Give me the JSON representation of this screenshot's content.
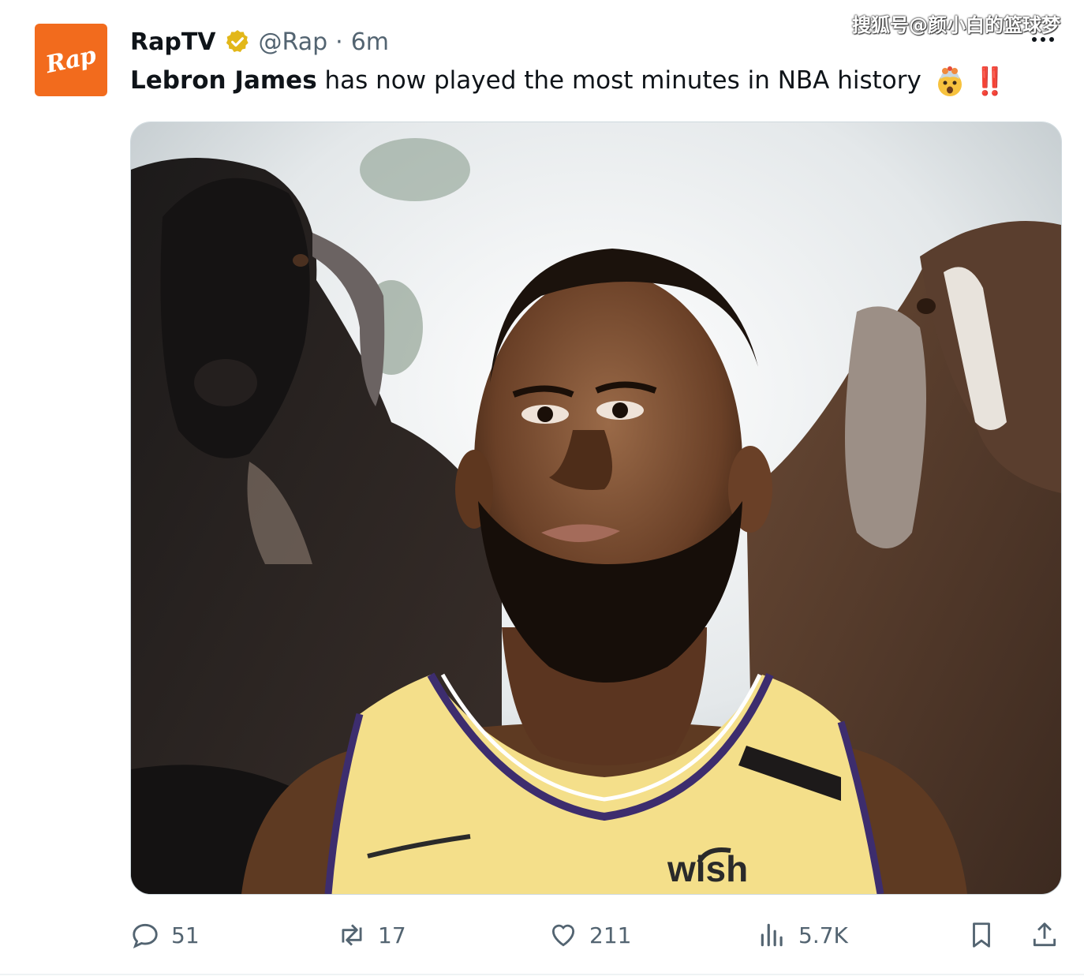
{
  "watermark": "搜狐号@颜小白的篮球梦",
  "author": {
    "avatar_text": "Rap",
    "display_name": "RapTV",
    "handle": "@Rap",
    "separator": "·",
    "time": "6m",
    "verified_color": "#e2b719"
  },
  "tweet": {
    "bold_name": "Lebron James",
    "text": "has now played the most minutes in NBA history",
    "exclaim": "‼️"
  },
  "media": {
    "jersey_brand": "wish"
  },
  "actions": {
    "replies": "51",
    "retweets": "17",
    "likes": "211",
    "views": "5.7K"
  },
  "colors": {
    "avatar_bg": "#f26b1d",
    "secondary_text": "#536471",
    "jersey": "#f4df8a",
    "jersey_trim": "#3d2d6e"
  }
}
